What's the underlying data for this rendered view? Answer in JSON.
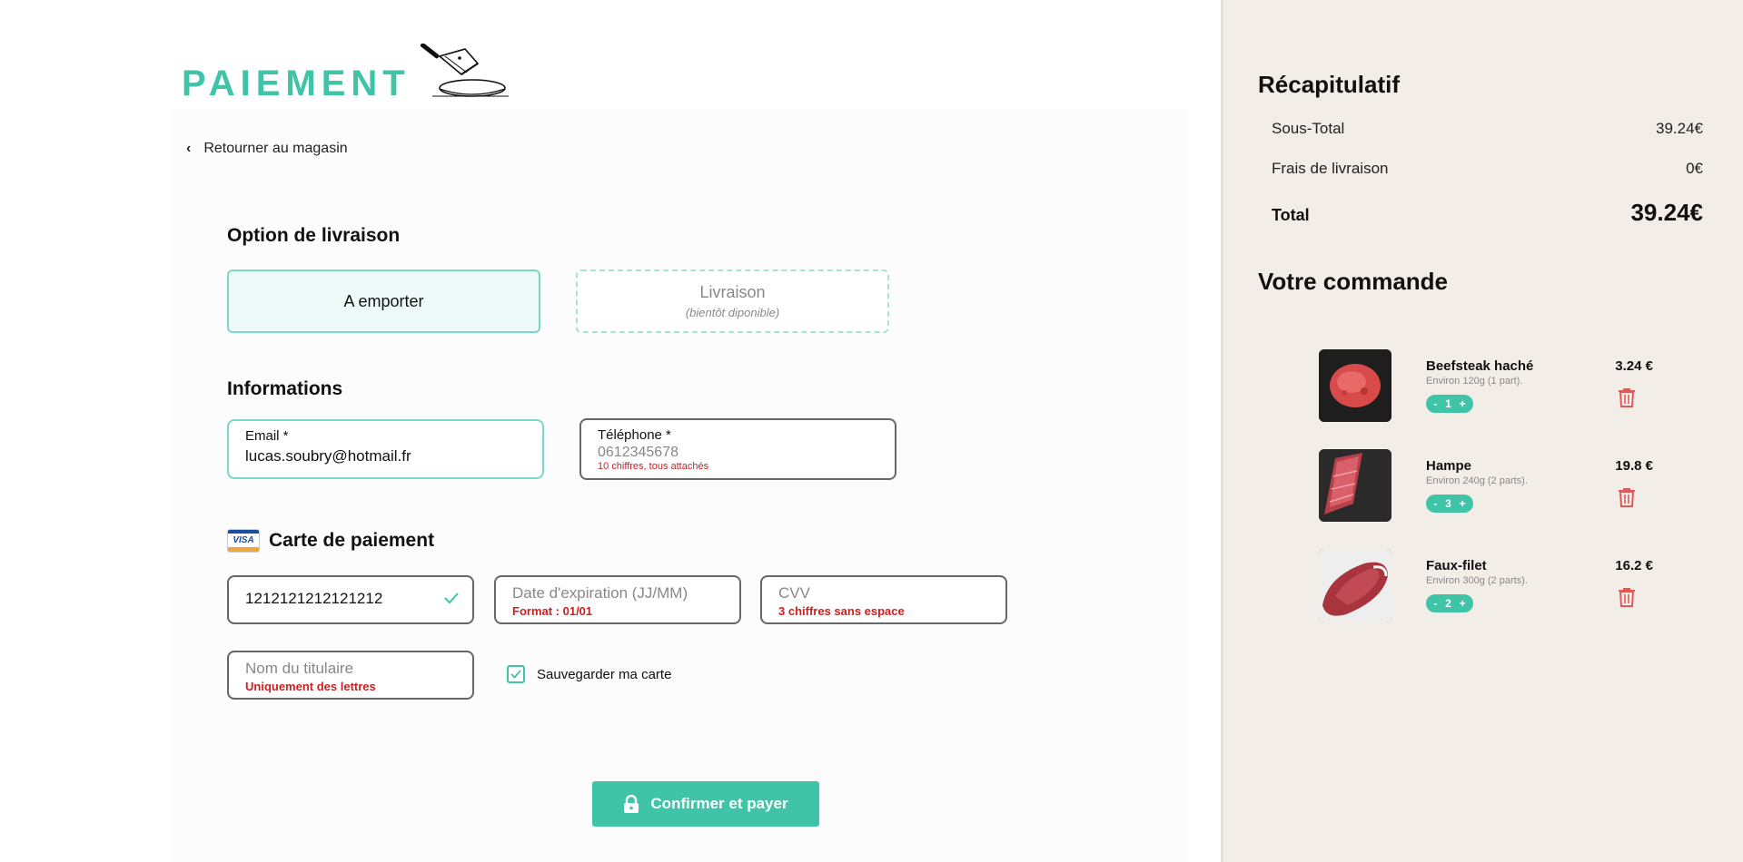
{
  "page": {
    "title": "PAIEMENT",
    "back_label": "Retourner au magasin"
  },
  "delivery": {
    "section_title": "Option de livraison",
    "options": [
      {
        "label": "A emporter",
        "selected": true
      },
      {
        "label": "Livraison",
        "note": "(bientôt diponible)",
        "selected": false
      }
    ]
  },
  "info": {
    "section_title": "Informations",
    "email": {
      "label": "Email *",
      "value": "lucas.soubry@hotmail.fr"
    },
    "phone": {
      "label": "Téléphone *",
      "placeholder": "0612345678",
      "hint": "10 chiffres, tous attachés"
    }
  },
  "card": {
    "section_title": "Carte de paiement",
    "visa_text": "VISA",
    "number": {
      "value": "1212121212121212",
      "valid": true
    },
    "expiry": {
      "placeholder": "Date d'expiration (JJ/MM)",
      "hint": "Format : 01/01"
    },
    "cvv": {
      "placeholder": "CVV",
      "hint": "3 chiffres sans espace"
    },
    "holder": {
      "placeholder": "Nom du titulaire",
      "hint": "Uniquement des lettres"
    },
    "save_label": "Sauvegarder ma carte",
    "save_checked": true
  },
  "confirm_label": "Confirmer et payer",
  "summary": {
    "title": "Récapitulatif",
    "subtotal_label": "Sous-Total",
    "subtotal_value": "39.24€",
    "shipping_label": "Frais de livraison",
    "shipping_value": "0€",
    "total_label": "Total",
    "total_value": "39.24€"
  },
  "order": {
    "title": "Votre commande",
    "items": [
      {
        "name": "Beefsteak haché",
        "desc": "Environ 120g (1 part).",
        "qty": "1",
        "price": "3.24 €"
      },
      {
        "name": "Hampe",
        "desc": "Environ 240g (2 parts).",
        "qty": "3",
        "price": "19.8 €"
      },
      {
        "name": "Faux-filet",
        "desc": "Environ 300g (2 parts).",
        "qty": "2",
        "price": "16.2 €"
      }
    ]
  },
  "colors": {
    "accent": "#3fc4a8",
    "error": "#cc1f1f",
    "trash": "#e05a5a",
    "sidebar_bg": "#f3ede8"
  }
}
